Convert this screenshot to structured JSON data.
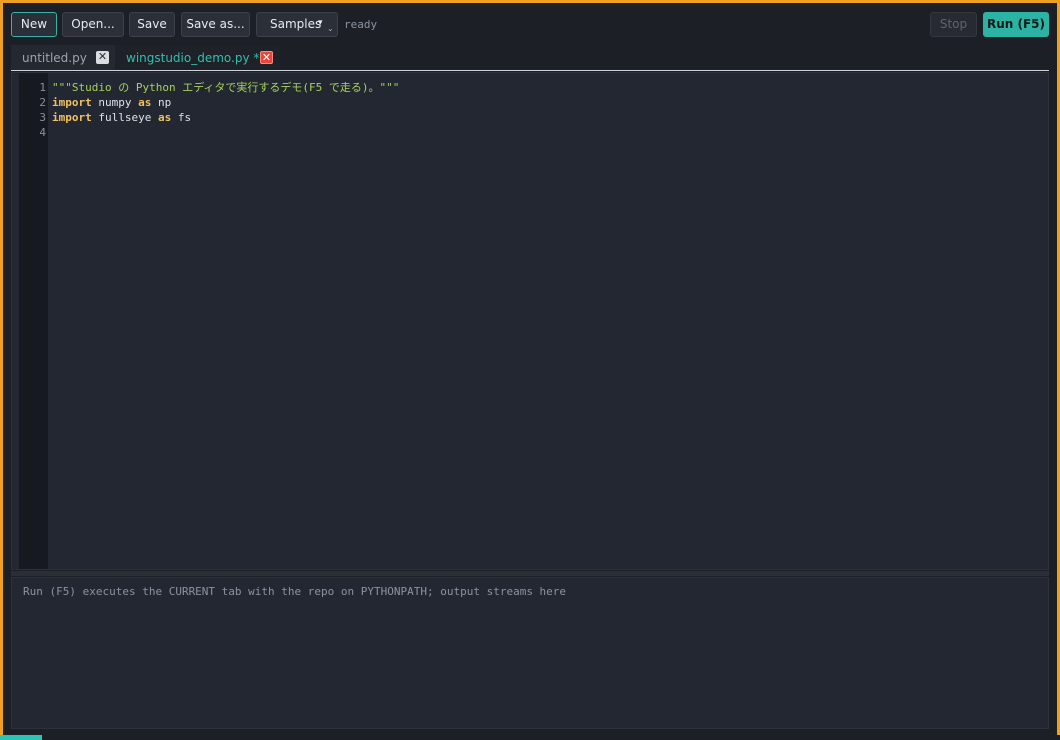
{
  "toolbar": {
    "new_label": "New",
    "open_label": "Open...",
    "save_label": "Save",
    "save_as_label": "Save as...",
    "samples_label": "Samples",
    "status": "ready",
    "stop_label": "Stop",
    "run_label": "Run (F5)"
  },
  "tabs": [
    {
      "label": "untitled.py",
      "active": false
    },
    {
      "label": "wingstudio_demo.py *",
      "active": true
    }
  ],
  "editor": {
    "line_numbers": [
      "1",
      "2",
      "3",
      "4"
    ],
    "lines": [
      {
        "tokens": [
          {
            "t": "\"\"\"Studio の Python エディタで実行するデモ(F5 で走る)。\"\"\"",
            "c": "str"
          }
        ]
      },
      {
        "tokens": [
          {
            "t": "import",
            "c": "kw"
          },
          {
            "t": " numpy ",
            "c": ""
          },
          {
            "t": "as",
            "c": "kw"
          },
          {
            "t": " np",
            "c": ""
          }
        ]
      },
      {
        "tokens": [
          {
            "t": "import",
            "c": "kw"
          },
          {
            "t": " fullseye ",
            "c": ""
          },
          {
            "t": "as",
            "c": "kw"
          },
          {
            "t": " fs",
            "c": ""
          }
        ]
      },
      {
        "tokens": []
      }
    ]
  },
  "output": {
    "placeholder": "Run (F5) executes the CURRENT tab with the repo on PYTHONPATH; output streams here"
  },
  "progress": {
    "fraction": 0.04
  },
  "colors": {
    "accent": "#2bb3a3",
    "window_border": "#f0a020",
    "keyword": "#f0c060",
    "string": "#a6d25a",
    "active_tab": "#2fc0b0",
    "close_active": "#e8463a"
  },
  "icons": {
    "tab_close": "close-icon",
    "samples_caret": "chevron-down-icon"
  }
}
